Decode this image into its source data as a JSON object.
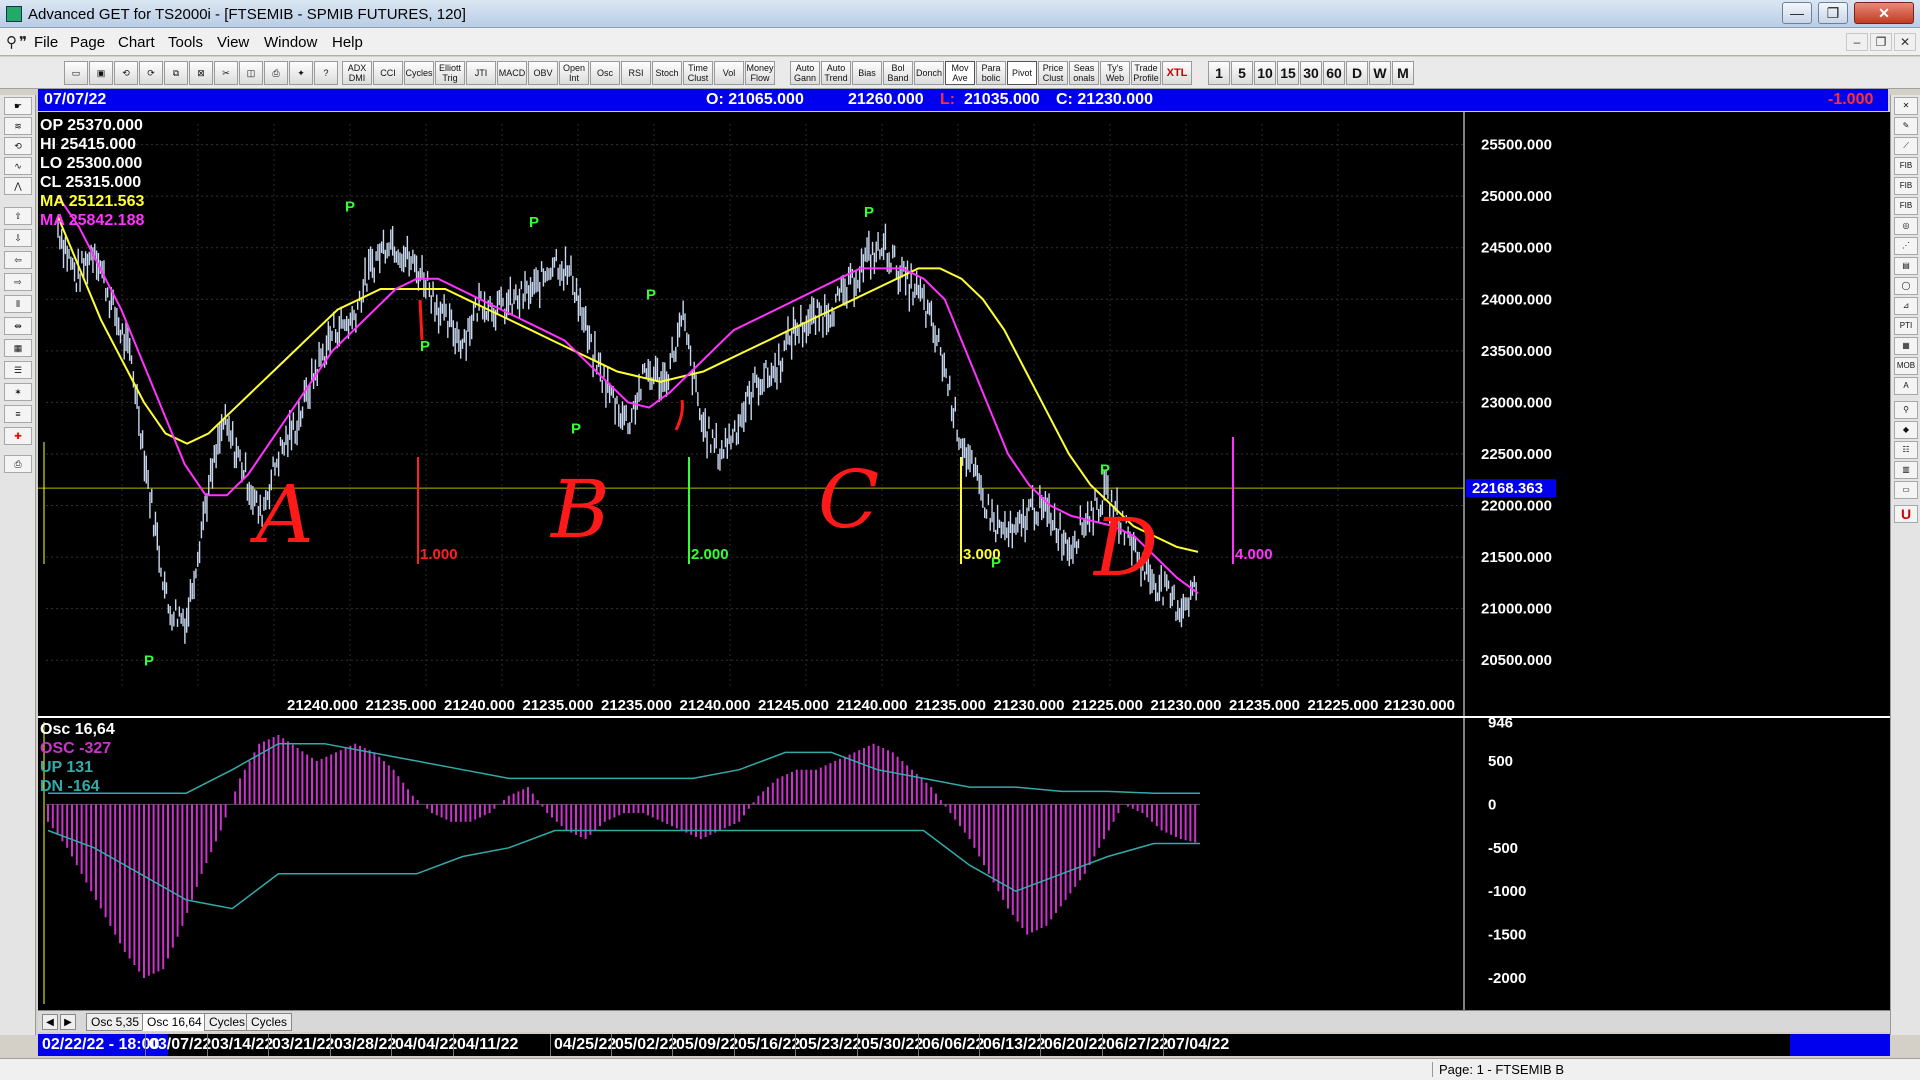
{
  "window": {
    "title": "Advanced GET for TS2000i - [FTSEMIB - SPMIB FUTURES, 120]",
    "min_glyph": "—",
    "max_glyph": "❐",
    "close_glyph": "✕"
  },
  "menu": {
    "items": [
      "File",
      "Page",
      "Chart",
      "Tools",
      "View",
      "Window",
      "Help"
    ],
    "mdi_min": "–",
    "mdi_restore": "❐",
    "mdi_close": "✕"
  },
  "toolbar": {
    "studies": [
      "ADX DMI",
      "CCI",
      "Cycles",
      "Elliott Trig",
      "JTI",
      "MACD",
      "OBV",
      "Open Int",
      "Osc",
      "RSI",
      "Stoch",
      "Time Clust",
      "Vol",
      "Money Flow"
    ],
    "tools": [
      "Auto Gann",
      "Auto Trend",
      "Bias",
      "Bol Band",
      "Donch",
      "Mov Ave",
      "Para bolic",
      "Pivot",
      "Price Clust",
      "Seas onals",
      "Ty's Web",
      "Trade Profile",
      "XTL"
    ],
    "timeframes": [
      "1",
      "5",
      "10",
      "15",
      "30",
      "60",
      "D",
      "W",
      "M"
    ]
  },
  "infobar": {
    "date": "07/07/22",
    "open": "O: 21065.000",
    "high": "21260.000",
    "low_label": "L:",
    "low": "21035.000",
    "close": "C: 21230.000",
    "change": "-1.000"
  },
  "price_legend": {
    "op": "OP  25370.000",
    "hi": "HI   25415.000",
    "lo": "LO   25300.000",
    "cl": "CL   25315.000",
    "ma1": "MA  25121.563",
    "ma2": "MA  25842.188"
  },
  "price_axis": {
    "ticks": [
      "25500.000",
      "25000.000",
      "24500.000",
      "24000.000",
      "23500.000",
      "23000.000",
      "22500.000",
      "22000.000",
      "21500.000",
      "21000.000",
      "20500.000"
    ],
    "current_price": "22168.363",
    "bottom_labels": [
      "21240.000",
      "21235.000",
      "21240.000",
      "21235.000",
      "21235.000",
      "21240.000",
      "21245.000",
      "21240.000",
      "21235.000",
      "21230.000",
      "21225.000",
      "21230.000",
      "21235.000",
      "21225.000"
    ],
    "bottom_last": "21230.000"
  },
  "chart_data": {
    "type": "line",
    "ylim": [
      20250,
      25700
    ],
    "close": [
      24700,
      24200,
      24500,
      23900,
      23400,
      22100,
      21000,
      20900,
      22000,
      22800,
      22400,
      21900,
      22500,
      22800,
      23300,
      23700,
      23800,
      24300,
      24600,
      24400,
      24200,
      23800,
      23600,
      24000,
      23900,
      24000,
      24100,
      24400,
      24200,
      23500,
      23100,
      22800,
      23300,
      23200,
      23800,
      22800,
      22500,
      22800,
      23200,
      23300,
      23700,
      23800,
      23900,
      24100,
      24400,
      24500,
      24200,
      24000,
      23500,
      22700,
      22200,
      21800,
      21700,
      22000,
      21900,
      21600,
      21900,
      22100,
      21800,
      21400,
      21200,
      21000,
      21230
    ],
    "ma_yellow": [
      24800,
      24300,
      23800,
      23400,
      23000,
      22700,
      22600,
      22700,
      22900,
      23100,
      23300,
      23500,
      23700,
      23900,
      24000,
      24100,
      24100,
      24100,
      24100,
      24000,
      23900,
      23800,
      23700,
      23600,
      23500,
      23400,
      23300,
      23250,
      23200,
      23250,
      23300,
      23400,
      23500,
      23600,
      23700,
      23800,
      23900,
      24000,
      24100,
      24200,
      24300,
      24300,
      24200,
      24000,
      23700,
      23300,
      22900,
      22500,
      22200,
      22000,
      21800,
      21700,
      21600,
      21550
    ],
    "ma_magenta": [
      25000,
      24700,
      24300,
      23900,
      23400,
      22900,
      22400,
      22100,
      22100,
      22300,
      22600,
      22900,
      23200,
      23500,
      23700,
      23900,
      24100,
      24200,
      24200,
      24100,
      24000,
      23900,
      23800,
      23700,
      23600,
      23400,
      23200,
      23000,
      22950,
      23100,
      23300,
      23500,
      23700,
      23800,
      23900,
      24000,
      24100,
      24200,
      24300,
      24300,
      24300,
      24200,
      24000,
      23500,
      23000,
      22500,
      22200,
      22000,
      21900,
      21850,
      21800,
      21700,
      21500,
      21300,
      21150
    ],
    "pivots": [
      {
        "label": "P",
        "value": 24850
      },
      {
        "label": "P",
        "value": 20450
      },
      {
        "label": "P",
        "value": 23500
      },
      {
        "label": "P",
        "value": 24700
      },
      {
        "label": "P",
        "value": 22700
      },
      {
        "label": "P",
        "value": 24000
      },
      {
        "label": "P",
        "value": 24800
      },
      {
        "label": "P",
        "value": 21400
      },
      {
        "label": "P",
        "value": 22300
      }
    ],
    "cycle_markers": [
      {
        "label": "1.000",
        "color": "#ff2020"
      },
      {
        "label": "2.000",
        "color": "#33ff33"
      },
      {
        "label": "3.000",
        "color": "#ffff33"
      },
      {
        "label": "4.000",
        "color": "#ff33ff"
      }
    ],
    "hand_labels": [
      "A",
      "B",
      "C",
      "D"
    ],
    "osc_legend": {
      "osc": "Osc 16,64",
      "osc_value": "OSC -327",
      "up": "UP   131",
      "dn": "DN   -164"
    },
    "osc_axis": [
      "946",
      "500",
      "0",
      "-500",
      "-1000",
      "-1500",
      "-2000"
    ],
    "osc_ylim": [
      -2300,
      950
    ],
    "osc_values": [
      -200,
      -500,
      -900,
      -1300,
      -1700,
      -2000,
      -1900,
      -1400,
      -800,
      -300,
      300,
      700,
      800,
      650,
      500,
      600,
      700,
      600,
      400,
      100,
      -100,
      -200,
      -200,
      -100,
      100,
      200,
      -100,
      -300,
      -400,
      -200,
      -100,
      -100,
      -200,
      -300,
      -400,
      -300,
      -200,
      100,
      300,
      400,
      400,
      500,
      600,
      700,
      600,
      400,
      200,
      -100,
      -400,
      -800,
      -1200,
      -1500,
      -1400,
      -1100,
      -800,
      -400,
      0,
      -100,
      -300,
      -400,
      -450
    ]
  },
  "tabs": {
    "prev": "◀",
    "next": "▶",
    "items": [
      "Osc 5,35",
      "Osc 16,64",
      "Cycles",
      "Cycles"
    ]
  },
  "date_axis": {
    "start": "02/22/22 - 18:00",
    "ticks": [
      "03/07/22",
      "03/14/22",
      "03/21/22",
      "03/28/22",
      "04/04/22",
      "04/11/22",
      "04/25/22",
      "05/02/22",
      "05/09/22",
      "05/16/22",
      "05/23/22",
      "05/30/22",
      "06/06/22",
      "06/13/22",
      "06/20/22",
      "06/27/22",
      "07/04/22"
    ]
  },
  "status": {
    "page": "Page: 1 - FTSEMIB B"
  },
  "colors": {
    "blue_bar": "#0000ee",
    "price": "#c8d8f0",
    "ma_yellow": "#ffff33",
    "ma_magenta": "#ff33ff",
    "pivot": "#33ff33",
    "hand_ink": "#ff1a1a",
    "osc": "#cc33cc",
    "osc_band": "#33aaaa"
  }
}
